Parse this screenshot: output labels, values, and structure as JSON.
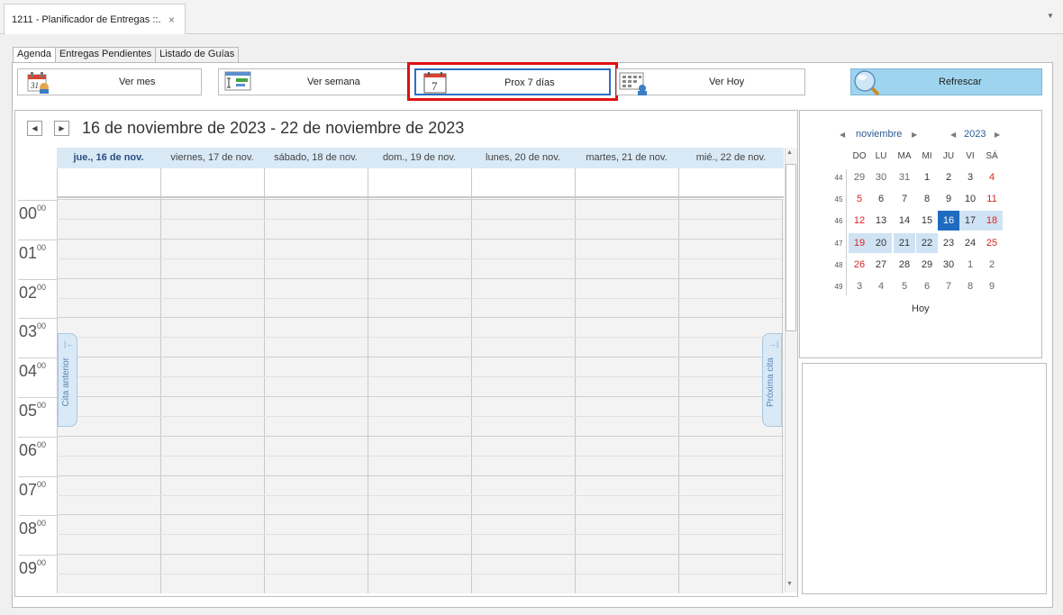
{
  "doc_tab": {
    "title": "1211 - Planificador de Entregas ::.",
    "close": "×",
    "dropdown": "▼"
  },
  "tabs": [
    "Agenda",
    "Entregas Pendientes",
    "Listado de Guías"
  ],
  "toolbar": {
    "ver_mes": "Ver mes",
    "ver_semana": "Ver semana",
    "prox7": "Prox 7 días",
    "ver_hoy": "Ver Hoy",
    "refrescar": "Refrescar",
    "month_icon_number": "31",
    "day_icon_number": "7"
  },
  "scheduler": {
    "prev": "◀",
    "next": "▶",
    "range_title": "16 de noviembre de 2023 - 22 de noviembre de 2023",
    "days": [
      "jue., 16 de nov.",
      "viernes, 17 de nov.",
      "sábado, 18 de nov.",
      "dom., 19 de nov.",
      "lunes, 20 de nov.",
      "martes, 21 de nov.",
      "mié., 22 de nov."
    ],
    "hours": [
      "00",
      "01",
      "02",
      "03",
      "04",
      "05",
      "06",
      "07",
      "08",
      "09"
    ],
    "minutes": "00",
    "prev_appt": "Cita anterior",
    "next_appt": "Próxima cita",
    "prev_appt_arrow": "|←",
    "next_appt_arrow": "→|",
    "scroll_up": "▲",
    "scroll_down": "▼"
  },
  "calendar": {
    "month": "noviembre",
    "year": "2023",
    "arrow_left": "◀",
    "arrow_right": "▶",
    "dow": [
      "DO",
      "LU",
      "MA",
      "MI",
      "JU",
      "VI",
      "SÁ"
    ],
    "weeks": [
      "44",
      "45",
      "46",
      "47",
      "48",
      "49"
    ],
    "rows": [
      [
        "29",
        "30",
        "31",
        "1",
        "2",
        "3",
        "4"
      ],
      [
        "5",
        "6",
        "7",
        "8",
        "9",
        "10",
        "11"
      ],
      [
        "12",
        "13",
        "14",
        "15",
        "16",
        "17",
        "18"
      ],
      [
        "19",
        "20",
        "21",
        "22",
        "23",
        "24",
        "25"
      ],
      [
        "26",
        "27",
        "28",
        "29",
        "30",
        "1",
        "2"
      ],
      [
        "3",
        "4",
        "5",
        "6",
        "7",
        "8",
        "9"
      ]
    ],
    "today_label": "Hoy",
    "colors": {
      "today_bg": "#1f6bbf",
      "range_bg": "#cfe3f4",
      "weekend": "#d22",
      "other_month": "#666"
    }
  }
}
